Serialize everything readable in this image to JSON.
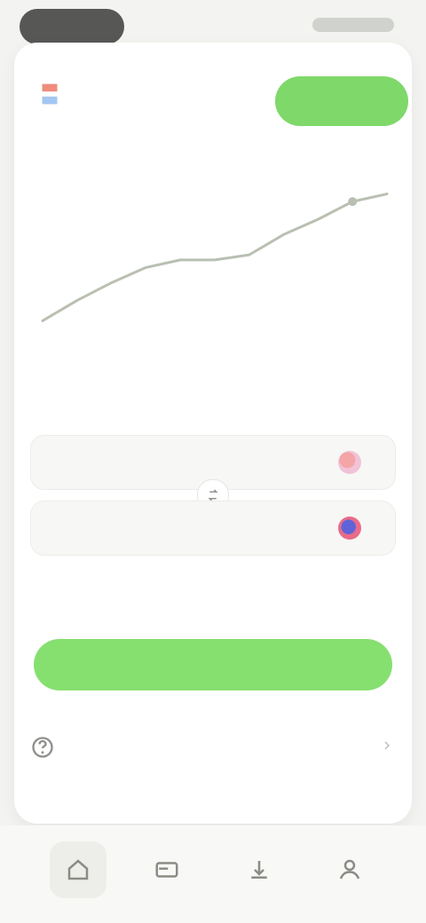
{
  "header": {
    "title": "",
    "action_label": ""
  },
  "section": {
    "chart_title": "",
    "converter_title": ""
  },
  "chart_data": {
    "type": "line",
    "title": "",
    "xlabel": "",
    "ylabel": "",
    "x": [
      0,
      1,
      2,
      3,
      4,
      5,
      6,
      7,
      8,
      9,
      10
    ],
    "values": [
      10,
      18,
      25,
      31,
      34,
      34,
      36,
      44,
      50,
      57,
      60
    ],
    "ylim": [
      0,
      70
    ],
    "grid": false,
    "legend": "none",
    "line_color": "#b9c0b2"
  },
  "converter": {
    "from_amount": "",
    "from_currency": "",
    "to_amount": "",
    "to_currency": ""
  },
  "rates": {
    "left_line1": "",
    "left_line2": "",
    "right_line1": "",
    "right_line2": ""
  },
  "primary": {
    "label": ""
  },
  "help": {
    "text": ""
  },
  "nav": {
    "home": "",
    "cards": "",
    "payments": "",
    "profile": ""
  },
  "colors": {
    "accent": "#7fd86a",
    "card": "#ffffff",
    "background": "#f3f4f1"
  },
  "icons": {
    "flag": "flag-icon",
    "swap": "swap-icon",
    "help": "help-icon",
    "chevron": "chevron-right-icon",
    "nav_home": "home-icon",
    "nav_cards": "card-icon",
    "nav_payments": "payments-icon",
    "nav_profile": "profile-icon"
  }
}
